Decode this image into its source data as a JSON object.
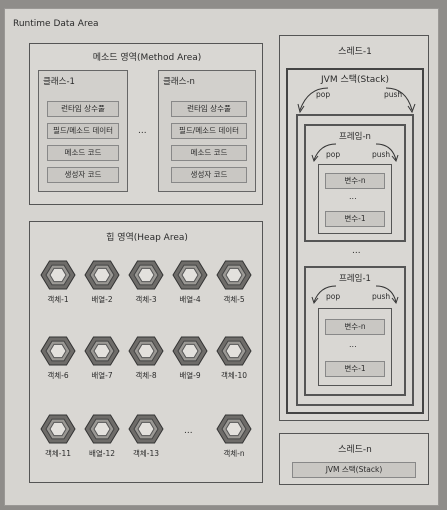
{
  "runtime": {
    "title": "Runtime Data Area"
  },
  "method_area": {
    "title": "메소드 영역(Method Area)",
    "classes": [
      {
        "name": "클래스-1",
        "items": [
          "런타임 상수풀",
          "필드/메소드 데이터",
          "메소드 코드",
          "생성자 코드"
        ]
      },
      {
        "name": "클래스-n",
        "items": [
          "런타임 상수풀",
          "필드/메소드 데이터",
          "메소드 코드",
          "생성자 코드"
        ]
      }
    ],
    "ellipsis": "..."
  },
  "heap_area": {
    "title": "힙 영역(Heap Area)",
    "rows": [
      [
        "객체-1",
        "배열-2",
        "객체-3",
        "배열-4",
        "객체-5"
      ],
      [
        "객체-6",
        "배열-7",
        "객체-8",
        "배열-9",
        "객체-10"
      ],
      [
        "객체-11",
        "배열-12",
        "객체-13"
      ]
    ],
    "ellipsis": "...",
    "last_object": "객체-n"
  },
  "thread1": {
    "title": "스레드-1",
    "stack_title": "JVM 스택(Stack)",
    "pop": "pop",
    "push": "push",
    "frames": [
      {
        "title": "프레임-n",
        "pop": "pop",
        "push": "push",
        "vars": [
          "변수-n",
          "변수-1"
        ],
        "ellipsis": "..."
      },
      {
        "title": "프레임-1",
        "pop": "pop",
        "push": "push",
        "vars": [
          "변수-n",
          "변수-1"
        ],
        "ellipsis": "..."
      }
    ],
    "frame_ellipsis": "..."
  },
  "thread_n": {
    "title": "스레드-n",
    "stack_title": "JVM 스택(Stack)"
  },
  "colors": {
    "page": "#d6d4d0",
    "border": "#555555",
    "pill": "#c9c7c3",
    "hex_outer": "#6e6c69",
    "hex_inner": "#e3e1dd"
  }
}
